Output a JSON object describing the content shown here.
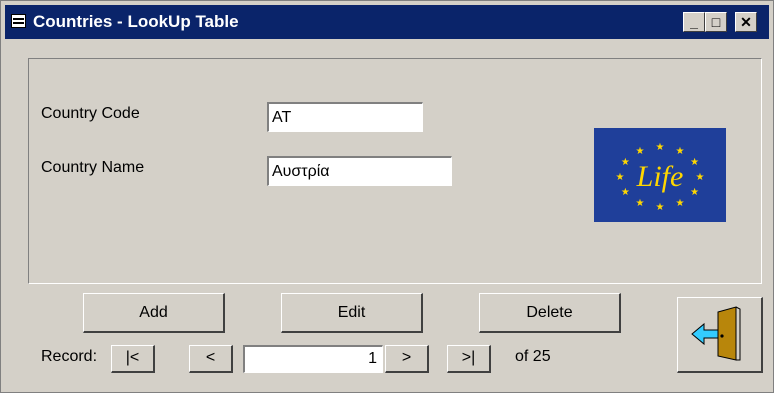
{
  "window": {
    "title": "Countries - LookUp Table",
    "minimize_glyph": "_",
    "maximize_glyph": "□",
    "close_glyph": "✕"
  },
  "form": {
    "country_code_label": "Country Code",
    "country_code_value": "AT",
    "country_name_label": "Country Name",
    "country_name_value": "Αυστρία",
    "logo_text": "Life",
    "logo_bg_color": "#1f3f9a",
    "logo_star_color": "#ffd700"
  },
  "buttons": {
    "add": "Add",
    "edit": "Edit",
    "delete": "Delete",
    "exit_icon": "exit-door-icon"
  },
  "navigation": {
    "record_label": "Record:",
    "first": "|<",
    "prev": "<",
    "current": "1",
    "next": ">",
    "last": ">|",
    "total": "of 25"
  }
}
